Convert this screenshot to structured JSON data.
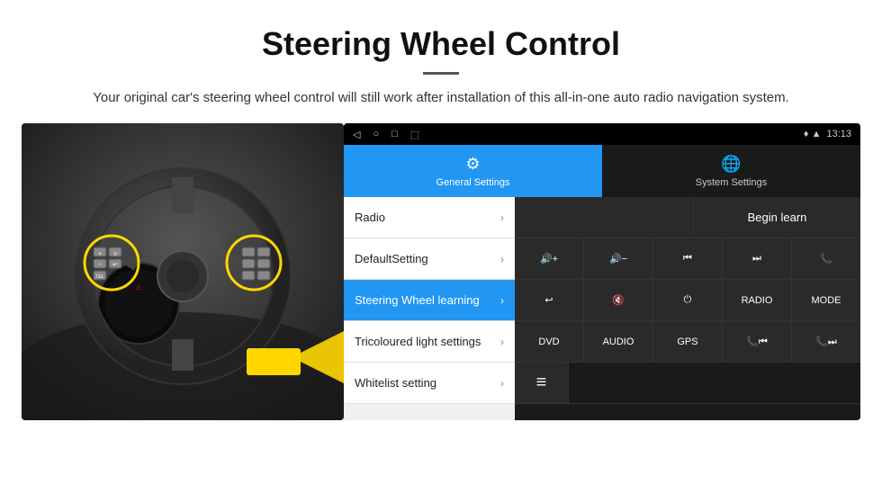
{
  "header": {
    "title": "Steering Wheel Control",
    "divider": true,
    "subtitle": "Your original car's steering wheel control will still work after installation of this all-in-one auto radio navigation system."
  },
  "statusBar": {
    "leftIcons": [
      "◁",
      "○",
      "□",
      "⬜"
    ],
    "rightIcons": "♦ ▲",
    "time": "13:13"
  },
  "tabs": [
    {
      "label": "General Settings",
      "icon": "⚙",
      "active": true
    },
    {
      "label": "System Settings",
      "icon": "🌐",
      "active": false
    }
  ],
  "menuItems": [
    {
      "label": "Radio",
      "active": false
    },
    {
      "label": "DefaultSetting",
      "active": false
    },
    {
      "label": "Steering Wheel learning",
      "active": true
    },
    {
      "label": "Tricoloured light settings",
      "active": false
    },
    {
      "label": "Whitelist setting",
      "active": false
    }
  ],
  "controls": {
    "beginLearn": "Begin learn",
    "row1": [
      {
        "icon": "🔊+",
        "label": "vol-up"
      },
      {
        "icon": "🔊-",
        "label": "vol-down"
      },
      {
        "icon": "⏮",
        "label": "prev"
      },
      {
        "icon": "⏭",
        "label": "next"
      },
      {
        "icon": "📞",
        "label": "phone"
      }
    ],
    "row2": [
      {
        "icon": "↩",
        "label": "back"
      },
      {
        "icon": "🔊✕",
        "label": "mute"
      },
      {
        "icon": "⏻",
        "label": "power"
      },
      {
        "text": "RADIO",
        "label": "radio"
      },
      {
        "text": "MODE",
        "label": "mode"
      }
    ],
    "row3": [
      {
        "text": "DVD",
        "label": "dvd"
      },
      {
        "text": "AUDIO",
        "label": "audio"
      },
      {
        "text": "GPS",
        "label": "gps"
      },
      {
        "icon": "📞⏮",
        "label": "phone-prev"
      },
      {
        "icon": "📞⏭",
        "label": "phone-next"
      }
    ],
    "row4": [
      {
        "icon": "≡",
        "label": "menu-icon"
      }
    ]
  }
}
